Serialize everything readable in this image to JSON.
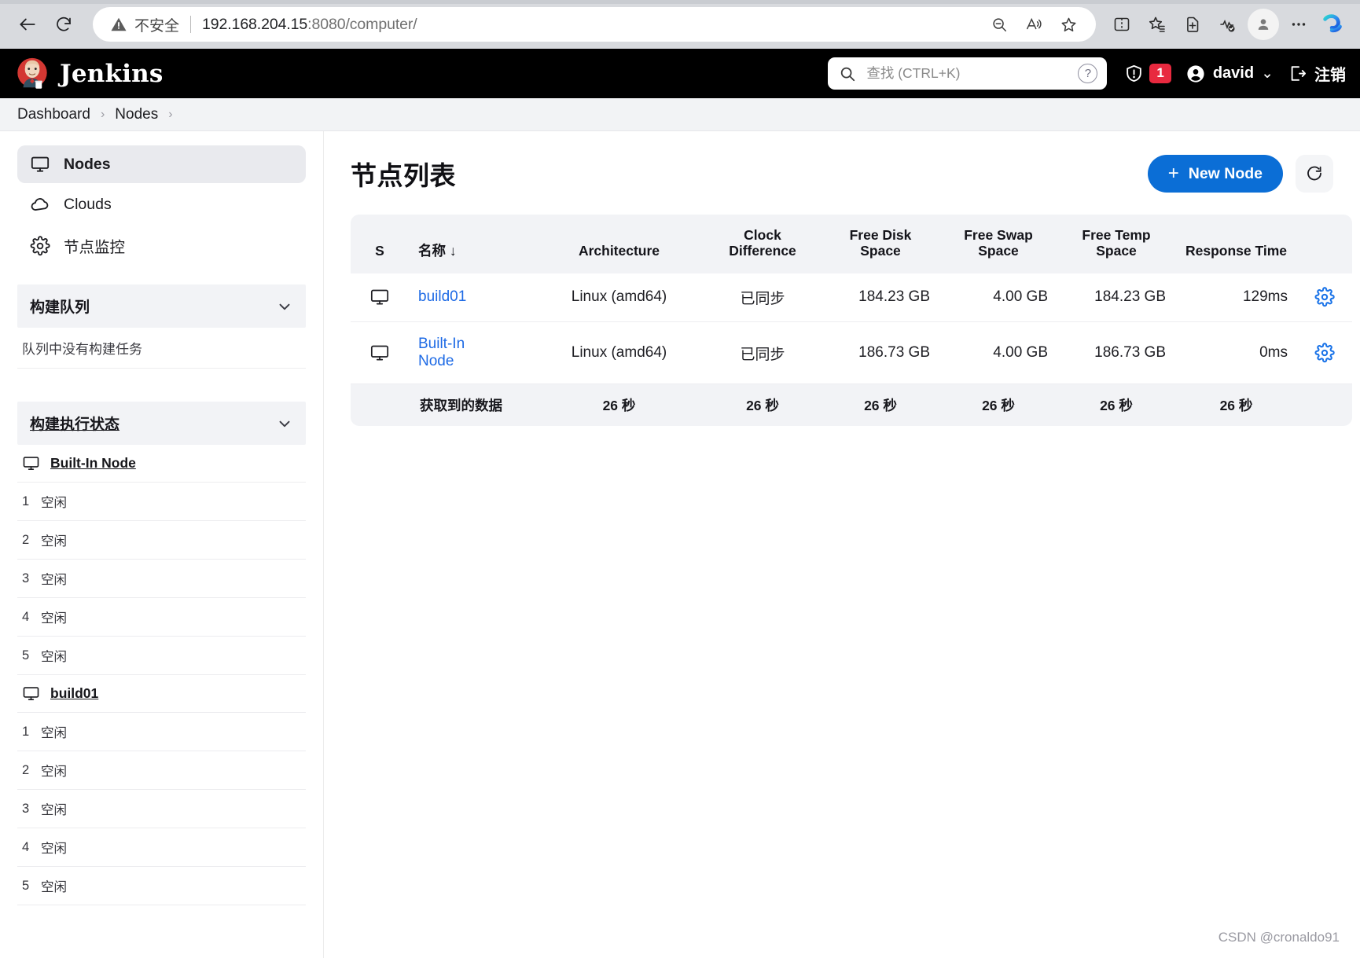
{
  "browser": {
    "back_label": "back-arrow",
    "reload_label": "reload",
    "security_text": "不安全",
    "url_host": "192.168.204.15",
    "url_rest": ":8080/computer/",
    "toolbar_icons": [
      "zoom-out-icon",
      "read-aloud-icon",
      "favorite-star-icon"
    ],
    "right_icons": [
      "split-screen-icon",
      "collections-icon",
      "add-page-icon",
      "browser-essentials-icon"
    ],
    "profile": "profile-avatar",
    "more": "…",
    "copilot": "copilot-icon"
  },
  "header": {
    "brand": "Jenkins",
    "search_placeholder": "查找 (CTRL+K)",
    "help_char": "?",
    "security_badge": "1",
    "user_name": "david",
    "user_chevron": "⌄",
    "logout_label": "注销"
  },
  "breadcrumb": {
    "items": [
      "Dashboard",
      "Nodes"
    ],
    "separator": "›"
  },
  "sidebar": {
    "nav": [
      {
        "label": "Nodes",
        "icon": "monitor-icon",
        "active": true
      },
      {
        "label": "Clouds",
        "icon": "cloud-icon",
        "active": false
      },
      {
        "label": "节点监控",
        "icon": "gear-icon",
        "active": false
      }
    ],
    "build_queue": {
      "title": "构建队列",
      "empty_text": "队列中没有构建任务"
    },
    "executors": {
      "title": "构建执行状态",
      "nodes": [
        {
          "name": "Built-In Node",
          "icon": "monitor-icon",
          "rows": [
            {
              "num": "1",
              "status": "空闲"
            },
            {
              "num": "2",
              "status": "空闲"
            },
            {
              "num": "3",
              "status": "空闲"
            },
            {
              "num": "4",
              "status": "空闲"
            },
            {
              "num": "5",
              "status": "空闲"
            }
          ]
        },
        {
          "name": "build01",
          "icon": "monitor-icon",
          "rows": [
            {
              "num": "1",
              "status": "空闲"
            },
            {
              "num": "2",
              "status": "空闲"
            },
            {
              "num": "3",
              "status": "空闲"
            },
            {
              "num": "4",
              "status": "空闲"
            },
            {
              "num": "5",
              "status": "空闲"
            }
          ]
        }
      ]
    }
  },
  "main": {
    "title": "节点列表",
    "new_node_label": "New Node",
    "new_node_plus": "+",
    "refresh_icon": "refresh-icon",
    "table": {
      "headers": {
        "status": "S",
        "name": "名称",
        "name_sort_arrow": "↓",
        "architecture": "Architecture",
        "clock_difference": "Clock Difference",
        "free_disk_space": "Free Disk Space",
        "free_swap_space": "Free Swap Space",
        "free_temp_space": "Free Temp Space",
        "response_time": "Response Time"
      },
      "rows": [
        {
          "status_icon": "monitor-icon",
          "name": "build01",
          "architecture": "Linux (amd64)",
          "clock_difference": "已同步",
          "free_disk_space": "184.23 GB",
          "free_swap_space": "4.00 GB",
          "free_temp_space": "184.23 GB",
          "response_time": "129ms",
          "config_icon": "gear-icon"
        },
        {
          "status_icon": "monitor-icon",
          "name": "Built-In Node",
          "architecture": "Linux (amd64)",
          "clock_difference": "已同步",
          "free_disk_space": "186.73 GB",
          "free_swap_space": "4.00 GB",
          "free_temp_space": "186.73 GB",
          "response_time": "0ms",
          "config_icon": "gear-icon"
        }
      ],
      "footer": {
        "label": "获取到的数据",
        "architecture": "26 秒",
        "clock_difference": "26 秒",
        "free_disk_space": "26 秒",
        "free_swap_space": "26 秒",
        "free_temp_space": "26 秒",
        "response_time": "26 秒"
      }
    }
  },
  "watermark": "CSDN @cronaldo91",
  "colors": {
    "accent_blue": "#0b6ed6",
    "link_blue": "#1d6ae5",
    "badge_red": "#e8293f",
    "header_black": "#000000"
  }
}
